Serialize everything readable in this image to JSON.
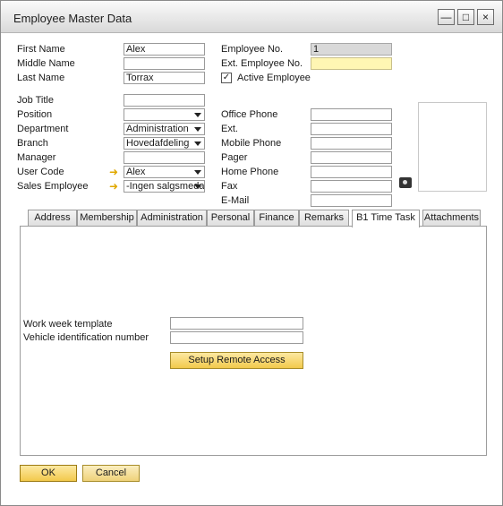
{
  "window": {
    "title": "Employee Master Data",
    "minimize": "—",
    "maximize": "□",
    "close": "×"
  },
  "left": {
    "first_name_label": "First Name",
    "first_name_value": "Alex",
    "middle_name_label": "Middle Name",
    "middle_name_value": "",
    "last_name_label": "Last Name",
    "last_name_value": "Torrax",
    "job_title_label": "Job Title",
    "job_title_value": "",
    "position_label": "Position",
    "position_value": "",
    "department_label": "Department",
    "department_value": "Administration",
    "branch_label": "Branch",
    "branch_value": "Hovedafdeling",
    "manager_label": "Manager",
    "manager_value": "",
    "user_code_label": "User Code",
    "user_code_value": "Alex",
    "sales_employee_label": "Sales Employee",
    "sales_employee_value": "-Ingen salgsmedarbejder-"
  },
  "right": {
    "employee_no_label": "Employee No.",
    "employee_no_value": "1",
    "ext_employee_no_label": "Ext. Employee No.",
    "ext_employee_no_value": "",
    "active_employee_label": "Active Employee",
    "active_employee_checked": "✓",
    "office_phone_label": "Office Phone",
    "ext_label": "Ext.",
    "mobile_phone_label": "Mobile Phone",
    "pager_label": "Pager",
    "home_phone_label": "Home Phone",
    "fax_label": "Fax",
    "email_label": "E-Mail"
  },
  "tabs": [
    {
      "label": "Address"
    },
    {
      "label": "Membership"
    },
    {
      "label": "Administration"
    },
    {
      "label": "Personal"
    },
    {
      "label": "Finance"
    },
    {
      "label": "Remarks"
    },
    {
      "label": "B1 Time Task"
    },
    {
      "label": "Attachments"
    }
  ],
  "active_tab": "B1 Time Task",
  "panel": {
    "work_week_label": "Work week template",
    "work_week_value": "",
    "vehicle_label": "Vehicle identification number",
    "vehicle_value": "",
    "setup_button": "Setup Remote Access"
  },
  "footer": {
    "ok_label": "OK",
    "cancel_label": "Cancel"
  },
  "colors": {
    "button_accent": "#f2c94c",
    "highlight_field": "#fff6b3"
  }
}
